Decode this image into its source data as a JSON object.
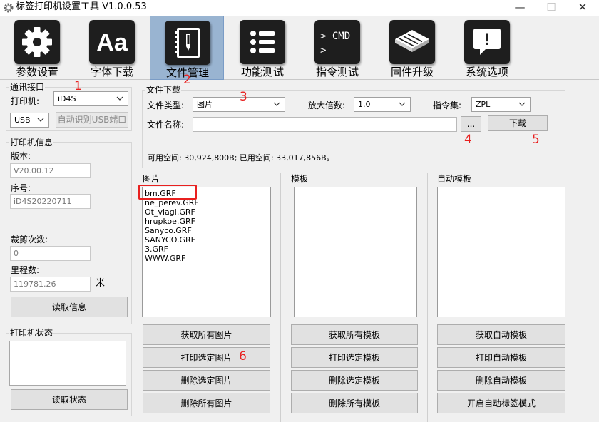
{
  "window": {
    "title": "标签打印机设置工具  V1.0.0.53",
    "min_glyph": "—",
    "max_glyph": "☐",
    "close_glyph": "✕"
  },
  "toolbar": {
    "items": [
      {
        "label": "参数设置",
        "icon": "gear-icon"
      },
      {
        "label": "字体下载",
        "icon": "font-aa-icon",
        "icon_text": "Aa"
      },
      {
        "label": "文件管理",
        "icon": "notebook-icon",
        "active": true
      },
      {
        "label": "功能测试",
        "icon": "list-icon"
      },
      {
        "label": "指令测试",
        "icon": "terminal-icon",
        "icon_text_1": "> CMD",
        "icon_text_2": ">_"
      },
      {
        "label": "固件升级",
        "icon": "chip-icon"
      },
      {
        "label": "系统选项",
        "icon": "alert-bubble-icon",
        "icon_text": "!"
      }
    ]
  },
  "comm": {
    "title": "通讯接口",
    "printer_label": "打印机:",
    "printer_value": "iD4S",
    "port_value": "USB",
    "auto_detect_label": "自动识别USB端口"
  },
  "printer_info": {
    "title": "打印机信息",
    "version_label": "版本:",
    "version_value": "V20.00.12",
    "serial_label": "序号:",
    "serial_value": "iD4S20220711",
    "cut_label": "裁剪次数:",
    "cut_value": "0",
    "mileage_label": "里程数:",
    "mileage_value": "119781.26",
    "mileage_unit": "米",
    "read_info_label": "读取信息"
  },
  "printer_status": {
    "title": "打印机状态",
    "read_status_label": "读取状态"
  },
  "download": {
    "title": "文件下载",
    "file_type_label": "文件类型:",
    "file_type_value": "图片",
    "zoom_label": "放大倍数:",
    "zoom_value": "1.0",
    "cmdset_label": "指令集:",
    "cmdset_value": "ZPL",
    "filename_label": "文件名称:",
    "filename_value": "",
    "browse_label": "...",
    "download_label": "下载",
    "space_text": "可用空间: 30,924,800B; 已用空间: 33,017,856B。"
  },
  "images": {
    "title": "图片",
    "items": [
      "bm.GRF",
      "ne_perev.GRF",
      "Ot_vlagi.GRF",
      "hrupkoe.GRF",
      "Sanyco.GRF",
      "SANYCO.GRF",
      "3.GRF",
      "WWW.GRF"
    ],
    "get_all": "获取所有图片",
    "print_selected": "打印选定图片",
    "delete_selected": "删除选定图片",
    "delete_all": "删除所有图片"
  },
  "templates": {
    "title": "模板",
    "get_all": "获取所有模板",
    "print_selected": "打印选定模板",
    "delete_selected": "删除选定模板",
    "delete_all": "删除所有模板"
  },
  "auto_templates": {
    "title": "自动模板",
    "get": "获取自动模板",
    "print": "打印自动模板",
    "delete": "删除自动模板",
    "enable": "开启自动标签模式"
  },
  "annotations": [
    "1",
    "2",
    "3",
    "4",
    "5",
    "6"
  ],
  "colors": {
    "annotation": "#e8201f",
    "active_tab": "#99b4d1",
    "icon_tile": "#1e1e1e"
  }
}
